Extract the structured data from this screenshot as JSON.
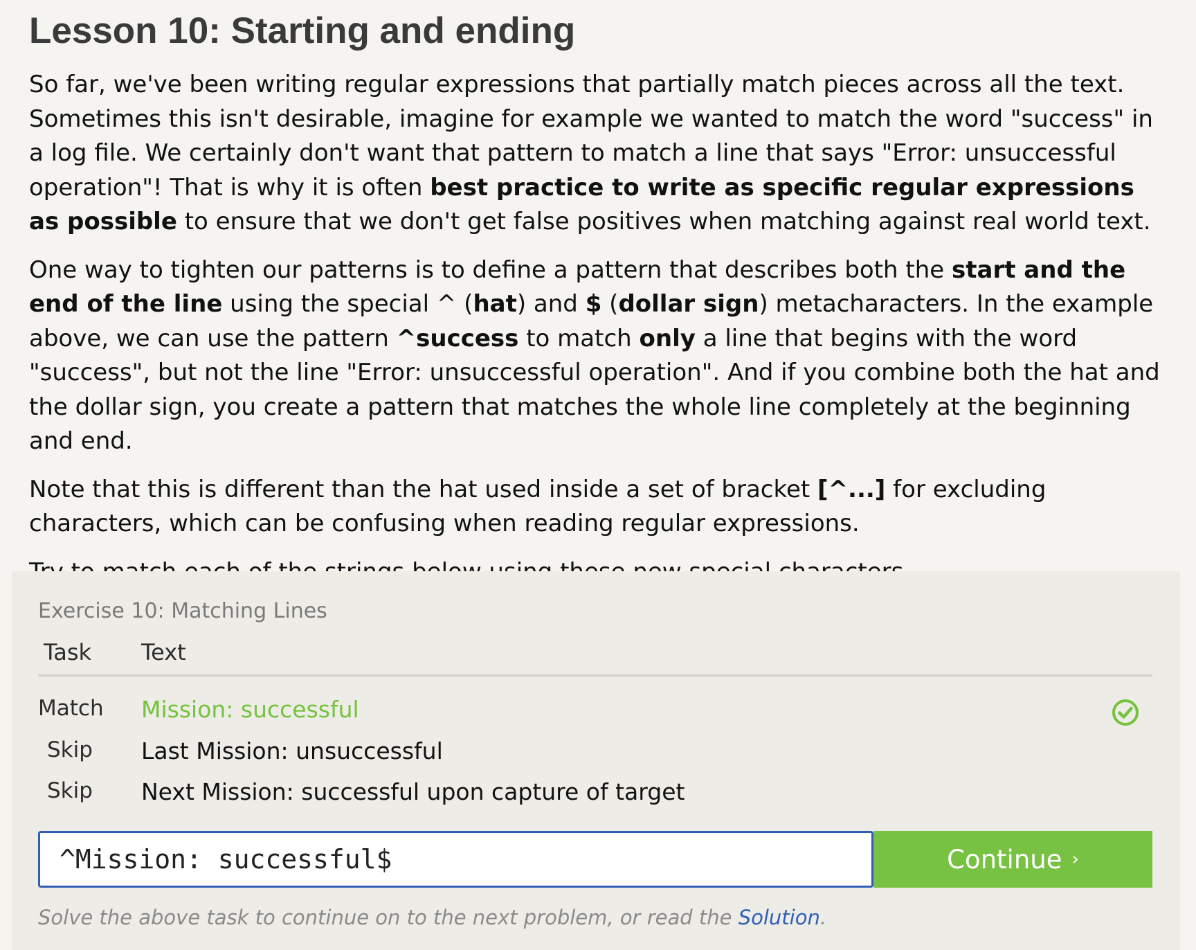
{
  "lesson": {
    "title": "Lesson 10: Starting and ending",
    "p1": {
      "a": "So far, we've been writing regular expressions that partially match pieces across all the text. Sometimes this isn't desirable, imagine for example we wanted to match the word \"success\" in a log file. We certainly don't want that pattern to match a line that says \"Error: unsuccessful operation\"! That is why it is often ",
      "b": "best practice to write as specific regular expressions as possible",
      "c": " to ensure that we don't get false positives when matching against real world text."
    },
    "p2": {
      "a": "One way to tighten our patterns is to define a pattern that describes both the ",
      "b": "start and the end of the line",
      "c": " using the special ^ (",
      "d": "hat",
      "e": ") and ",
      "f": "$",
      "g": " (",
      "h": "dollar sign",
      "i": ") metacharacters. In the example above, we can use the pattern ",
      "j": "^success",
      "k": " to match ",
      "l": "only",
      "m": " a line that begins with the word \"success\", but not the line \"Error: unsuccessful operation\". And if you combine both the hat and the dollar sign, you create a pattern that matches the whole line completely at the beginning and end."
    },
    "p3": {
      "a": "Note that this is different than the hat used inside a set of bracket ",
      "b": "[^...]",
      "c": " for excluding characters, which can be confusing when reading regular expressions."
    },
    "p4": "Try to match each of the strings below using these new special characters."
  },
  "exercise": {
    "title": "Exercise 10: Matching Lines",
    "columns": {
      "task": "Task",
      "text": "Text"
    },
    "rows": [
      {
        "task": "Match",
        "text": "Mission: successful",
        "status": "matched",
        "icon": "check-circle-icon"
      },
      {
        "task": "Skip",
        "text": "Last Mission: unsuccessful"
      },
      {
        "task": "Skip",
        "text": "Next Mission: successful upon capture of target"
      }
    ],
    "input_value": "^Mission: successful$",
    "continue_label": "Continue",
    "continue_chevron": "›",
    "hint_prefix": "Solve the above task to continue on to the next problem, or read the ",
    "hint_link": "Solution",
    "hint_suffix": ".",
    "colors": {
      "accent_green": "#78c243",
      "match_text": "#74c23d",
      "link_blue": "#2f5fb5"
    }
  }
}
